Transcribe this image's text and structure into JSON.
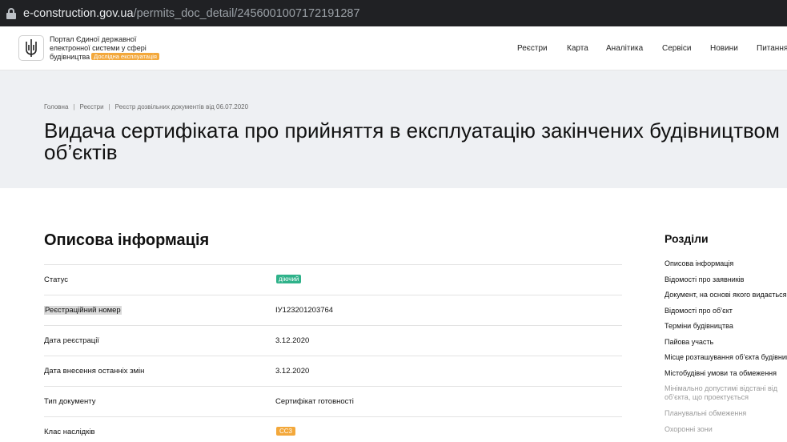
{
  "browser": {
    "url_domain": "e-construction.gov.ua",
    "url_path": "/permits_doc_detail/2456001007172191287"
  },
  "header": {
    "portal_name_line1": "Портал Єдиної державної",
    "portal_name_line2": "електронної системи у сфері",
    "portal_name_line3": "будівництва",
    "beta_badge": "Дослідна експлуатація",
    "nav": [
      "Реєстри",
      "Карта",
      "Аналітика",
      "Сервіси",
      "Новини",
      "Питання"
    ]
  },
  "breadcrumb": [
    "Головна",
    "Реєстри",
    "Реєстр дозвільних документів від 06.07.2020"
  ],
  "page_title": "Видача сертифіката про прийняття в експлуатацію закінчених будівництвом об’єктів",
  "main": {
    "section_title": "Описова інформація",
    "rows": [
      {
        "label": "Статус",
        "value": "діючий"
      },
      {
        "label": "Реєстраційний номер",
        "value": "ІУ123201203764"
      },
      {
        "label": "Дата реєстрації",
        "value": "3.12.2020"
      },
      {
        "label": "Дата внесення останніх змін",
        "value": "3.12.2020"
      },
      {
        "label": "Тип документу",
        "value": "Сертифікат готовності"
      },
      {
        "label": "Клас наслідків",
        "value": "СС3"
      }
    ]
  },
  "sidebar": {
    "title": "Розділи",
    "items": [
      "Описова інформація",
      "Відомості про заявників",
      "Документ, на основі якого видається",
      "Відомості про об’єкт",
      "Терміни будівництва",
      "Пайова участь",
      "Місце розташування об’єкта будівництва",
      "Містобудівні умови та обмеження",
      "Мінімально допустимі відстані від об’єкта, що проектується",
      "Планувальні обмеження",
      "Охоронні зони"
    ]
  },
  "colors": {
    "status_badge": "#2fb28a",
    "class_badge": "#f3a83b",
    "hero_bg": "#eef0f3"
  }
}
